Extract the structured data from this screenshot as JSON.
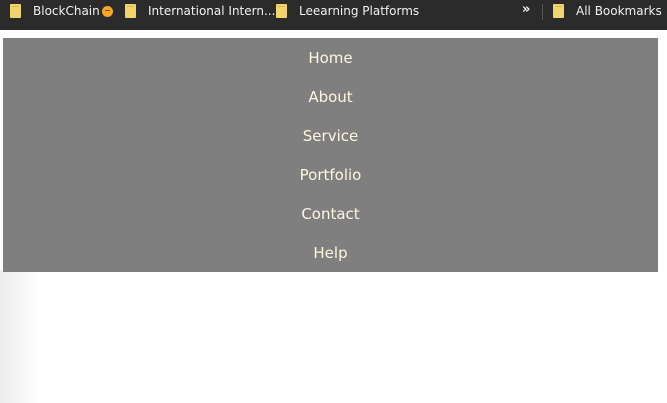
{
  "bookmarks_bar": {
    "items": [
      {
        "label": "BlockChain",
        "icon": "folder-icon",
        "badge": "emoji-icon"
      },
      {
        "label": "International Intern...",
        "icon": "folder-icon"
      },
      {
        "label": "Leearning Platforms",
        "icon": "folder-icon"
      }
    ],
    "overflow": "»",
    "all_bookmarks": "All Bookmarks"
  },
  "nav": {
    "items": [
      "Home",
      "About",
      "Service",
      "Portfolio",
      "Contact",
      "Help"
    ]
  },
  "colors": {
    "bookmarks_bar_bg": "#2b2b2b",
    "nav_bg": "#7f7f7f",
    "nav_text": "#fff6e0",
    "folder": "#f3d36b"
  }
}
